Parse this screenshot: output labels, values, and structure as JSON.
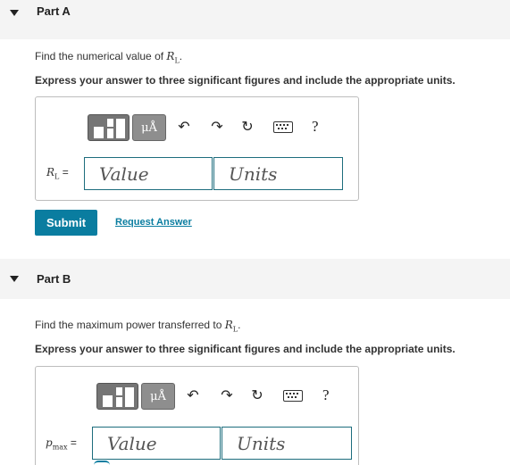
{
  "partA": {
    "title": "Part A",
    "question_prefix": "Find the numerical value of ",
    "var_symbol": "R",
    "var_sub": "L",
    "question_suffix": ".",
    "instruction": "Express your answer to three significant figures and include the appropriate units.",
    "label_symbol": "R",
    "label_sub": "L",
    "label_eq": "=",
    "value_placeholder": "Value",
    "units_placeholder": "Units",
    "submit_label": "Submit",
    "request_label": "Request Answer"
  },
  "partB": {
    "title": "Part B",
    "question_prefix": "Find the maximum power transferred to ",
    "var_symbol": "R",
    "var_sub": "L",
    "question_suffix": ".",
    "instruction": "Express your answer to three significant figures and include the appropriate units.",
    "label_symbol": "p",
    "label_sub": "max",
    "label_eq": "=",
    "value_placeholder": "Value",
    "units_placeholder": "Units"
  },
  "toolbar": {
    "units_button": "μÅ",
    "undo_icon": "↶",
    "redo_icon": "↷",
    "reset_icon": "↻",
    "help": "?"
  },
  "colors": {
    "accent": "#0a7da0",
    "input_border": "#1d6d7d",
    "header_bg": "#f4f4f4"
  }
}
